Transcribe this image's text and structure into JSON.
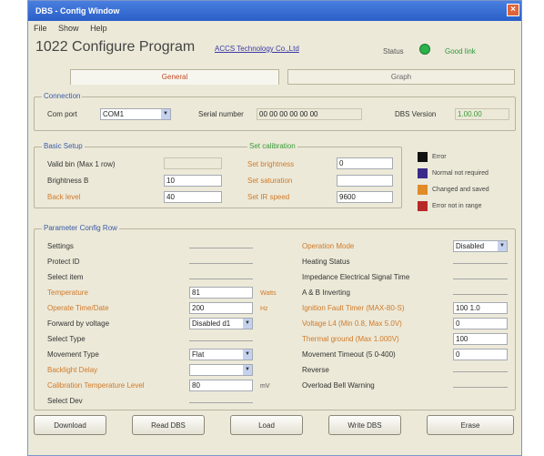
{
  "window": {
    "title": "DBS - Config Window"
  },
  "menu": [
    "File",
    "Show",
    "Help"
  ],
  "header": {
    "app_title": "1022 Configure Program",
    "company_link": "ACCS Technology Co.,Ltd",
    "status_label": "Status",
    "status_text": "Good link",
    "status_color": "#2bb24a"
  },
  "tabs": [
    {
      "label": "General",
      "active": true
    },
    {
      "label": "Graph",
      "active": false
    }
  ],
  "connection": {
    "title": "Connection",
    "port_label": "Com port",
    "port_value": "COM1",
    "serial_label": "Serial number",
    "serial_value": "00 00 00 00 00 00",
    "fw_label": "DBS Version",
    "fw_value": "1.00.00"
  },
  "basic": {
    "title": "Basic Setup",
    "label_1": "Valid bin (Max 1 row)",
    "label_2": "Brightness B",
    "label_3": "Back level",
    "value_2": "10",
    "value_3": "40",
    "sub_title": "Set calibration",
    "olabel_1": "Set brightness",
    "olabel_2": "Set saturation",
    "olabel_3": "Set IR speed",
    "ovalue_1": "0",
    "ovalue_3": "9600"
  },
  "legend": [
    {
      "color": "#111111",
      "label": "Error"
    },
    {
      "color": "#3a2a8a",
      "label": "Normal not required"
    },
    {
      "color": "#e08a2a",
      "label": "Changed and saved"
    },
    {
      "color": "#b82a2a",
      "label": "Error not in range"
    }
  ],
  "params": {
    "title": "Parameter Config Row",
    "left_labels": [
      "Settings",
      "Protect ID",
      "Select item",
      "Temperature",
      "Operate Time/Date",
      "Forward by voltage",
      "Select Type",
      "Movement Type",
      "Backlight Delay",
      "Calibration Temperature Level",
      "Select Dev"
    ],
    "left_orange": [
      false,
      false,
      false,
      true,
      true,
      false,
      false,
      false,
      true,
      true,
      false
    ],
    "left_values": [
      "",
      "",
      "",
      "81",
      "200",
      "Disabled d1",
      "",
      "Flat",
      "",
      "80",
      ""
    ],
    "left_units": [
      "",
      "",
      "",
      "Watts",
      "Hz",
      "",
      "",
      "",
      "",
      "mV",
      ""
    ],
    "right_labels": [
      "Operation Mode",
      "Heating Status",
      "Impedance Electrical Signal Time",
      "A & B Inverting",
      "Ignition Fault Timer (MAX-80-S)",
      "Voltage L4 (Min 0.8, Max 5.0V)",
      "Thermal ground (Max 1.000V)",
      "Movement Timeout (5 0-400)",
      "Reverse",
      "Overload Bell Warning"
    ],
    "right_orange": [
      true,
      false,
      false,
      false,
      true,
      true,
      true,
      false,
      false,
      false
    ],
    "right_values": [
      "Disabled",
      "",
      "",
      "",
      "100 1.0",
      "0",
      "100",
      "0",
      "",
      ""
    ]
  },
  "buttons": [
    "Download",
    "Read DBS",
    "Load",
    "Write DBS",
    "Erase"
  ]
}
